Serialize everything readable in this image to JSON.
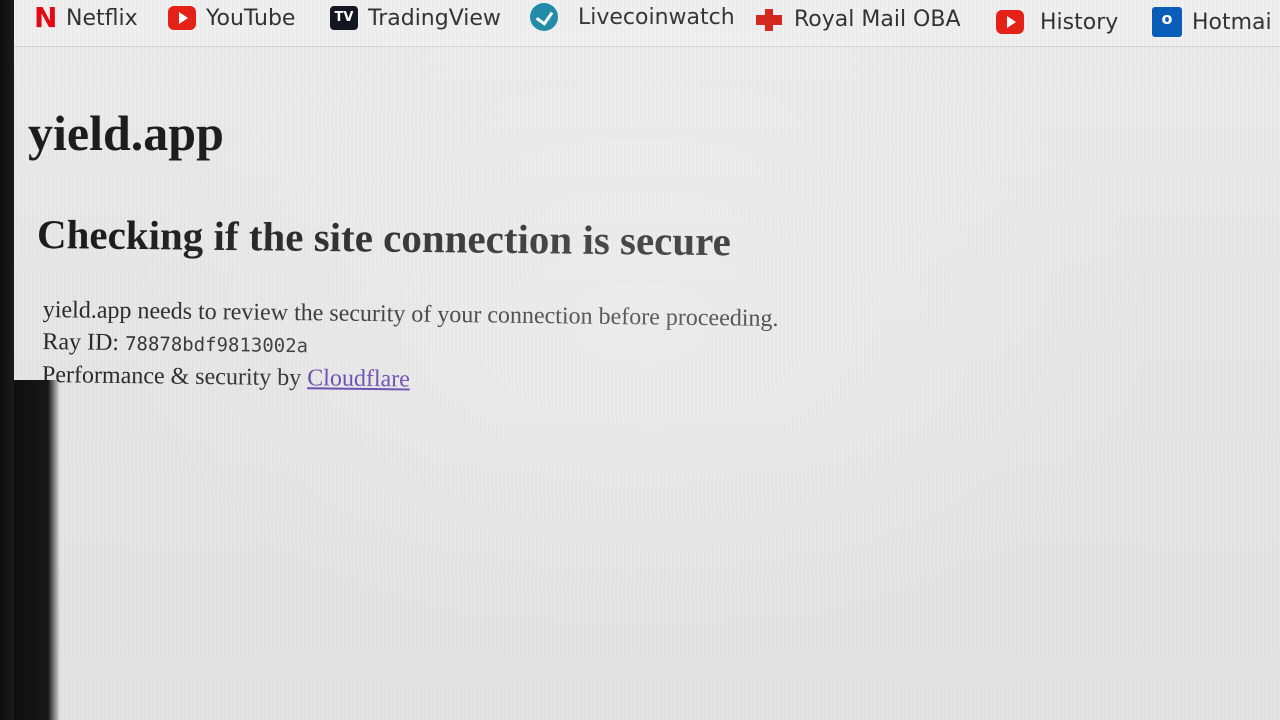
{
  "bookmarks": [
    {
      "label": "Netflix",
      "icon": "netflix-icon"
    },
    {
      "label": "YouTube",
      "icon": "youtube-icon"
    },
    {
      "label": "TradingView",
      "icon": "tradingview-icon"
    },
    {
      "label": "Livecoinwatch",
      "icon": "livecoinwatch-icon"
    },
    {
      "label": "Royal Mail OBA",
      "icon": "royal-mail-icon"
    },
    {
      "label": "History",
      "icon": "youtube-icon"
    },
    {
      "label": "Hotmai",
      "icon": "outlook-icon"
    }
  ],
  "icon_glyphs": {
    "netflix": "N",
    "tradingview": "TV",
    "outlook": "o"
  },
  "page": {
    "site_name": "yield.app",
    "heading": "Checking if the site connection is secure",
    "description": "yield.app needs to review the security of your connection before proceeding.",
    "ray_id_label": "Ray ID:",
    "ray_id_value": "78878bdf9813002a",
    "performance_text": "Performance & security by",
    "cloudflare_link": "Cloudflare"
  },
  "colors": {
    "link": "#5b3fa8",
    "netflix_red": "#e50914",
    "youtube_red": "#e62117",
    "tradingview_dark": "#131722",
    "livecoinwatch_blue": "#1f8aa8",
    "royal_mail_red": "#d4251d",
    "outlook_blue": "#0a5db8"
  }
}
